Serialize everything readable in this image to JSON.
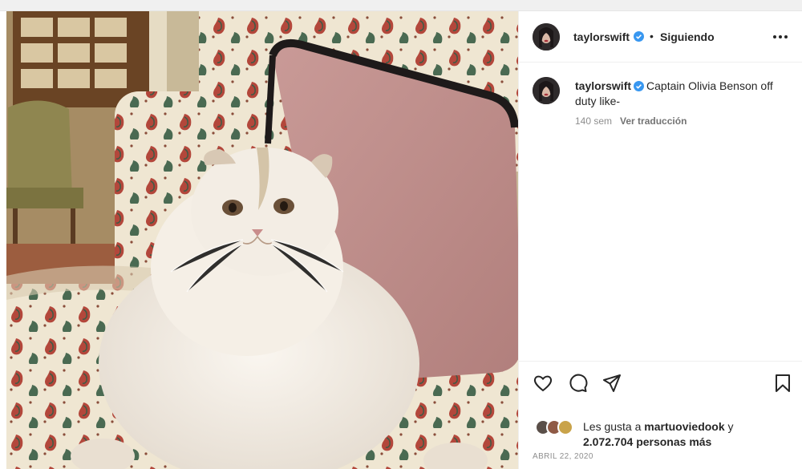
{
  "post": {
    "author": "taylorswift",
    "follow_state": "Siguiendo",
    "separator": "•",
    "caption": {
      "username": "taylorswift",
      "text": "Captain Olivia Benson off duty like-",
      "age": "140 sem",
      "translate_label": "Ver traducción"
    },
    "likes": {
      "prefix": "Les gusta a",
      "first_user": "martuoviedook",
      "connector": "y",
      "count": "2.072.704",
      "others_label": "personas más"
    },
    "date": "ABRIL 22, 2020"
  },
  "icons": {
    "more": "more-horizontal-icon",
    "like": "heart-icon",
    "comment": "comment-icon",
    "share": "share-icon",
    "save": "bookmark-icon",
    "verified": "verified-badge-icon"
  },
  "colors": {
    "verified": "#3897f0",
    "text": "#262626",
    "muted": "#8e8e8e",
    "border": "#efefef"
  }
}
